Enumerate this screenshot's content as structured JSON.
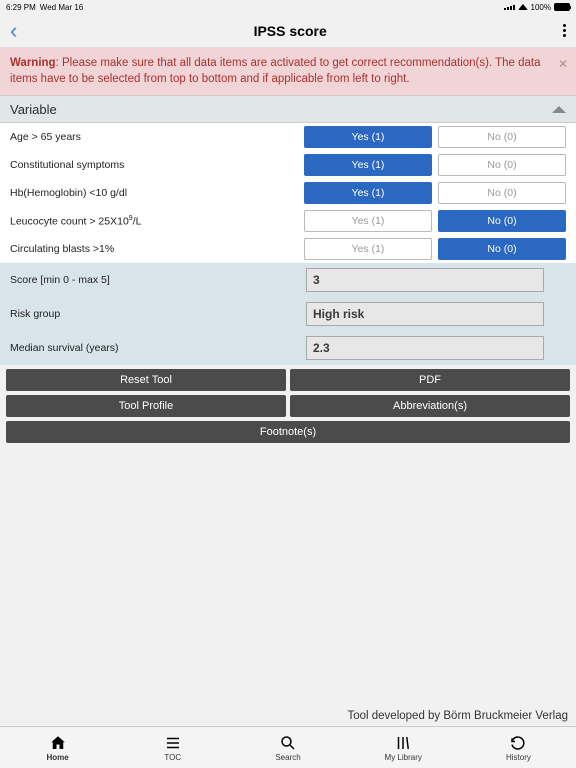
{
  "status": {
    "time": "6:29 PM",
    "date": "Wed Mar 16",
    "battery": "100%"
  },
  "header": {
    "title": "IPSS score"
  },
  "warning": {
    "bold": "Warning",
    "text": ": Please make sure that all data items are activated to get correct recommendation(s). The data items have to be selected from top to bottom and if applicable from left to right."
  },
  "section": {
    "title": "Variable"
  },
  "rows": [
    {
      "label": "Age > 65 years",
      "yes": "Yes (1)",
      "no": "No (0)",
      "selected": "yes"
    },
    {
      "label": "Constitutional symptoms",
      "yes": "Yes (1)",
      "no": "No (0)",
      "selected": "yes"
    },
    {
      "label": "Hb(Hemoglobin) <10 g/dl",
      "yes": "Yes (1)",
      "no": "No (0)",
      "selected": "yes"
    },
    {
      "label": "Leucocyte count > 25X10⁹/L",
      "yes": "Yes (1)",
      "no": "No (0)",
      "selected": "no"
    },
    {
      "label": "Circulating blasts >1%",
      "yes": "Yes (1)",
      "no": "No (0)",
      "selected": "no"
    }
  ],
  "results": [
    {
      "label": "Score [min 0 - max 5]",
      "value": "3"
    },
    {
      "label": "Risk group",
      "value": "High risk"
    },
    {
      "label": "Median survival (years)",
      "value": "2.3"
    }
  ],
  "actions": {
    "reset": "Reset Tool",
    "pdf": "PDF",
    "profile": "Tool Profile",
    "abbrev": "Abbreviation(s)",
    "footnote": "Footnote(s)"
  },
  "credit": "Tool developed by Börm Bruckmeier Verlag",
  "tabs": [
    {
      "label": "Home",
      "active": true
    },
    {
      "label": "TOC",
      "active": false
    },
    {
      "label": "Search",
      "active": false
    },
    {
      "label": "My Library",
      "active": false
    },
    {
      "label": "History",
      "active": false
    }
  ]
}
